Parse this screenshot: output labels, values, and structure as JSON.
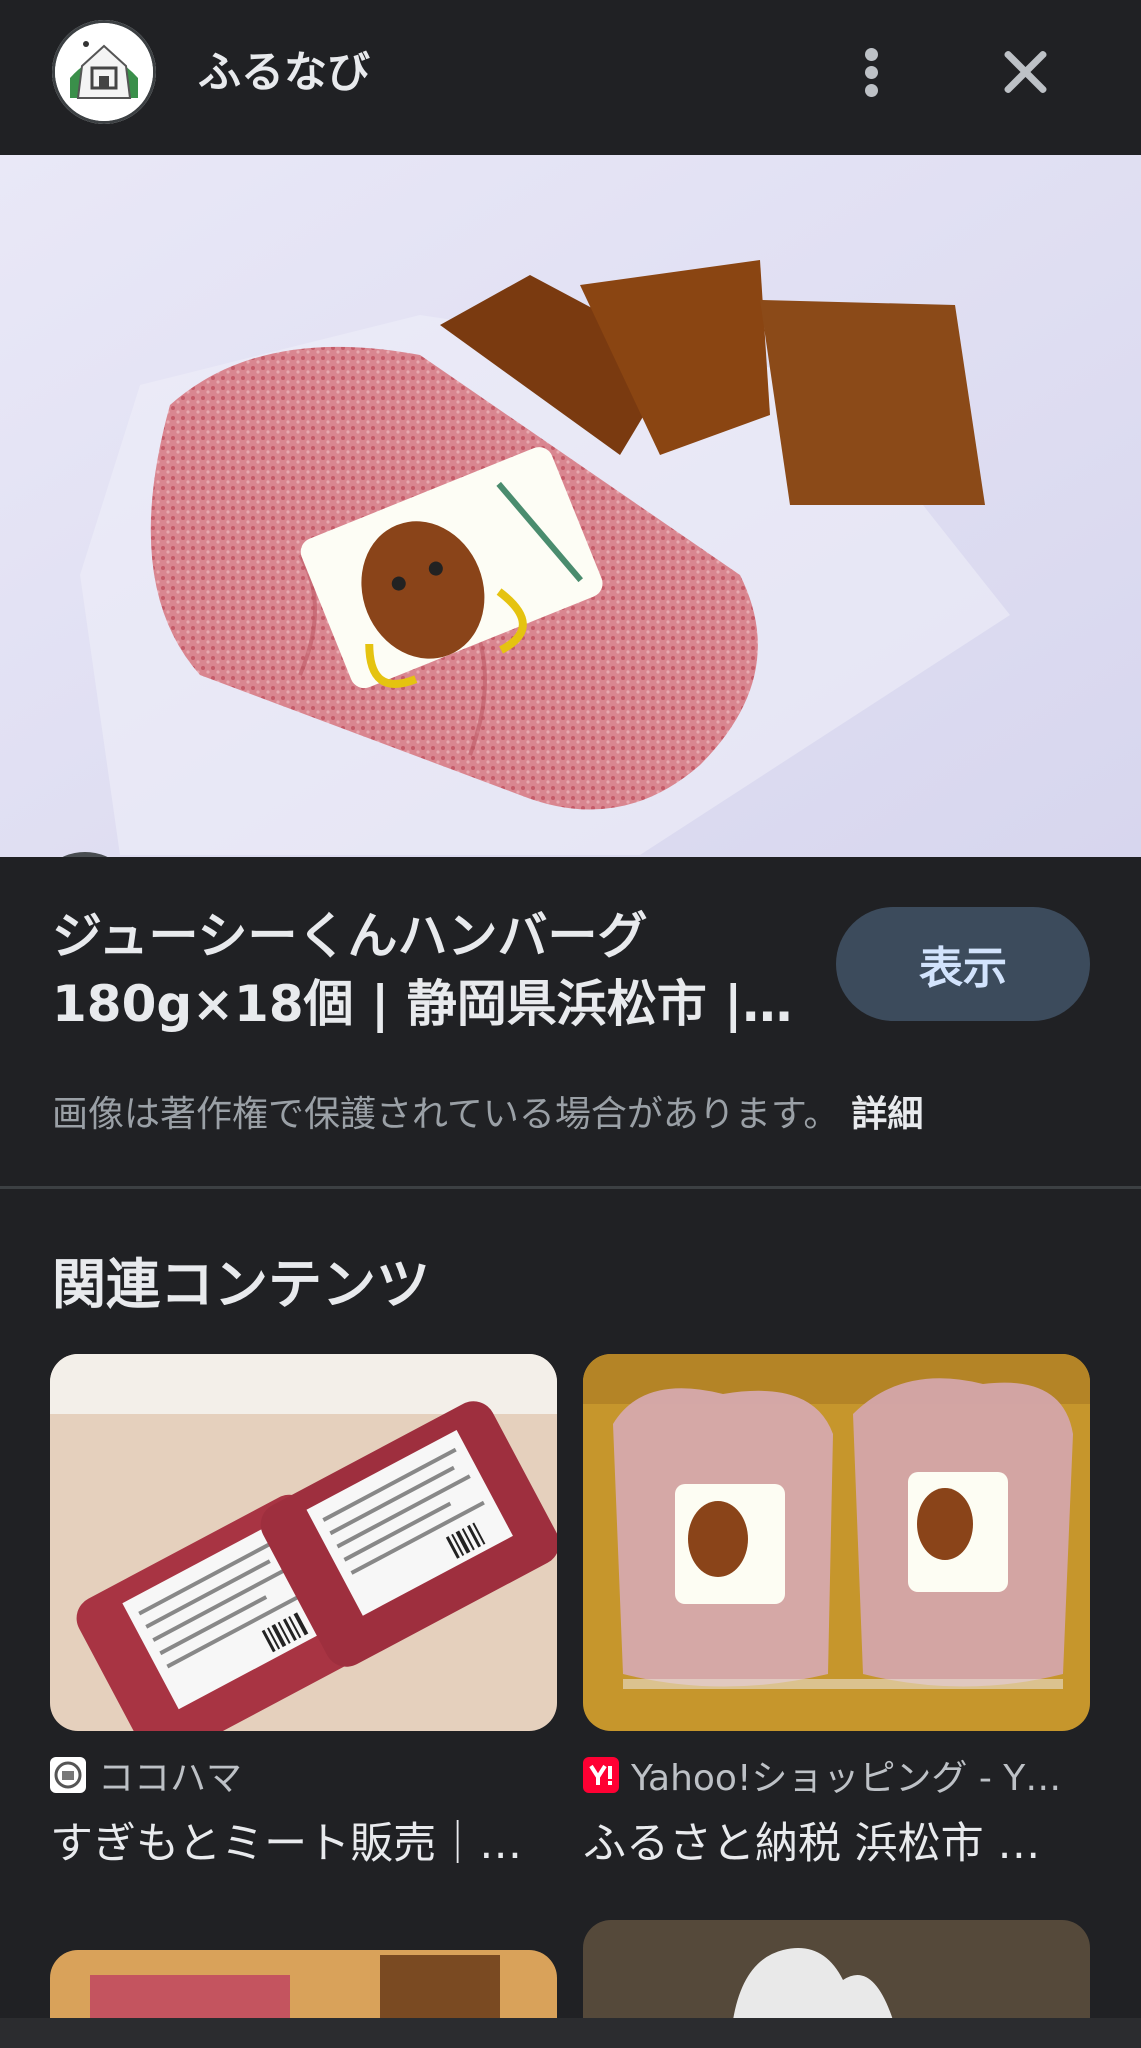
{
  "header": {
    "site_name": "ふるなび",
    "logo_icon": "furunavi-logo-icon",
    "more_icon": "more-vertical-icon",
    "close_icon": "close-icon"
  },
  "hero": {
    "image_alt": "ジューシーくんハンバーグ",
    "lens_icon": "lens-icon"
  },
  "result": {
    "title_line1": "ジューシーくんハンバーグ",
    "title_line2": "180g×18個 | 静岡県浜松市 |…",
    "view_button": "表示",
    "copyright_text": "画像は著作権で保護されている場合があります。",
    "detail_link": "詳細"
  },
  "related": {
    "heading": "関連コンテンツ",
    "cards": [
      {
        "source": "ココハマ",
        "title": "すぎもとミート販売｜…"
      },
      {
        "source": "Yahoo!ショッピング - Y…",
        "title": "ふるさと納税 浜松市 …"
      }
    ]
  },
  "colors": {
    "background": "#202124",
    "view_button_bg": "#3c4b5c",
    "view_button_text": "#d2e3fc",
    "yahoo_red": "#ff0033"
  }
}
